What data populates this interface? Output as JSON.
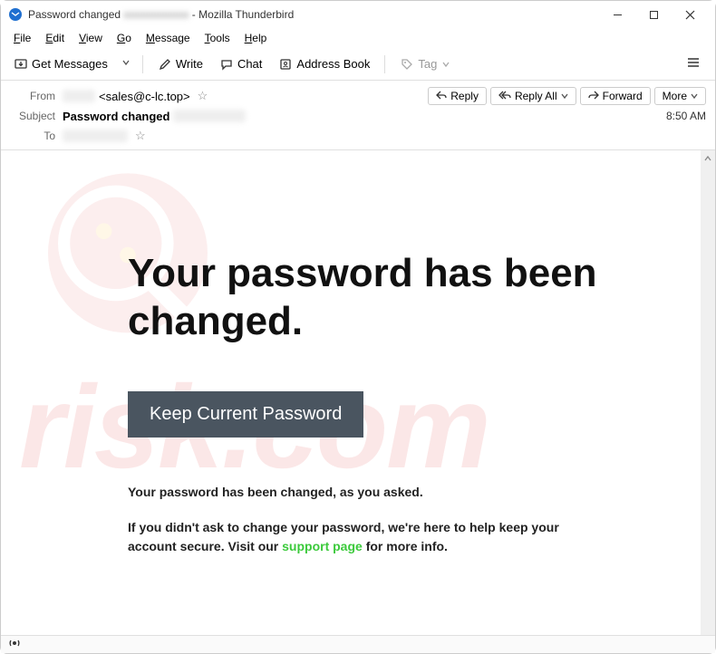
{
  "window": {
    "title_prefix": "Password changed",
    "title_suffix": " - Mozilla Thunderbird"
  },
  "menubar": {
    "file": "File",
    "edit": "Edit",
    "view": "View",
    "go": "Go",
    "message": "Message",
    "tools": "Tools",
    "help": "Help"
  },
  "toolbar": {
    "get_messages": "Get Messages",
    "write": "Write",
    "chat": "Chat",
    "address_book": "Address Book",
    "tag": "Tag"
  },
  "header": {
    "from_label": "From",
    "subject_label": "Subject",
    "to_label": "To",
    "from_value": "<sales@c-lc.top>",
    "subject_value": "Password changed",
    "time": "8:50 AM"
  },
  "actions": {
    "reply": "Reply",
    "reply_all": "Reply All",
    "forward": "Forward",
    "more": "More"
  },
  "email": {
    "headline": "Your password has been changed.",
    "cta": "Keep Current Password",
    "line1": "Your password has been changed, as you asked.",
    "line2a": "If you didn't ask to change your password, we're here to help keep your account secure. Visit our ",
    "support_link": "support page",
    "line2b": " for more info."
  },
  "watermark": {
    "text": "risk.com"
  }
}
